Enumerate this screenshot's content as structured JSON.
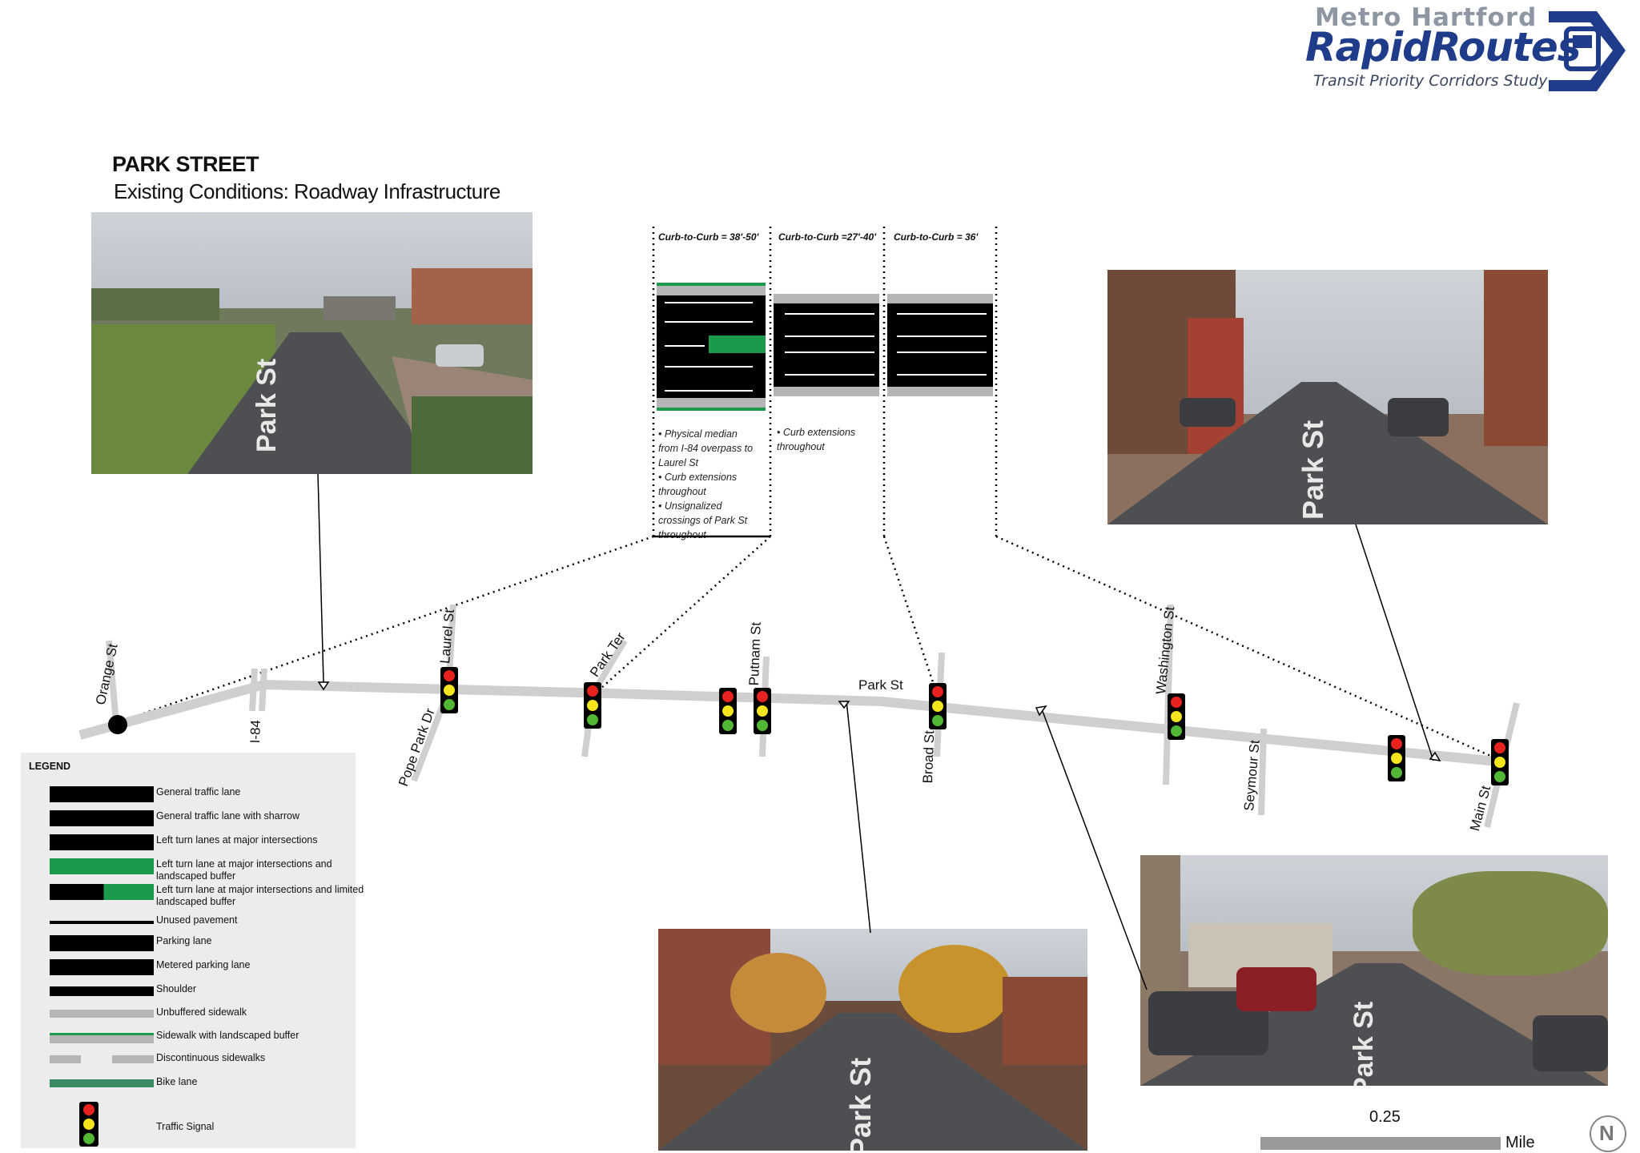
{
  "logo": {
    "line1": "Metro Hartford",
    "line2": "RapidRoutes",
    "line3": "Transit Priority Corridors Study",
    "color": "#1f3c8a"
  },
  "header": {
    "title": "PARK STREET",
    "subtitle": "Existing Conditions: Roadway Infrastructure"
  },
  "photos": {
    "photo1_label": "Park St",
    "photo2_label": "Park St",
    "photo3_label": "Park St",
    "photo4_label": "Park St"
  },
  "cross_sections": [
    {
      "heading": "Curb-to-Curb = 38'-50'",
      "notes": [
        "• Physical median from I-84 overpass to Laurel St",
        "• Curb extensions throughout",
        "•  Unsignalized crossings of Park St throughout"
      ]
    },
    {
      "heading": "Curb-to-Curb =27'-40'",
      "notes": [
        "• Curb extensions throughout"
      ]
    },
    {
      "heading": "Curb-to-Curb = 36'",
      "notes": []
    }
  ],
  "map": {
    "street_name": "Park St",
    "cross_streets": [
      "Orange St",
      "I-84",
      "Pope Park Dr",
      "Laurel St",
      "Park Ter",
      "Putnam St",
      "Broad St",
      "Washington St",
      "Seymour St",
      "Main St"
    ]
  },
  "scale": {
    "value": "0.25",
    "unit": "Mile"
  },
  "north_arrow": "N",
  "legend": {
    "title": "LEGEND",
    "items": [
      "General traffic lane",
      "General traffic lane with sharrow",
      "Left turn lanes at major intersections",
      "Left turn lane at major intersections and landscaped buffer",
      "Left turn lane at major intersections and limited landscaped buffer",
      "Unused pavement",
      "Parking lane",
      "Metered parking lane",
      "Shoulder",
      "Unbuffered sidewalk",
      "Sidewalk with landscaped buffer",
      "Discontinuous sidewalks",
      "Bike lane",
      "Traffic Signal"
    ]
  },
  "colors": {
    "green": "#1a9a4a",
    "asphalt": "#000000",
    "sidewalk": "#b5b5b5",
    "signal_red": "#e8231f",
    "signal_yellow": "#f4e51c",
    "signal_green": "#52b734"
  }
}
